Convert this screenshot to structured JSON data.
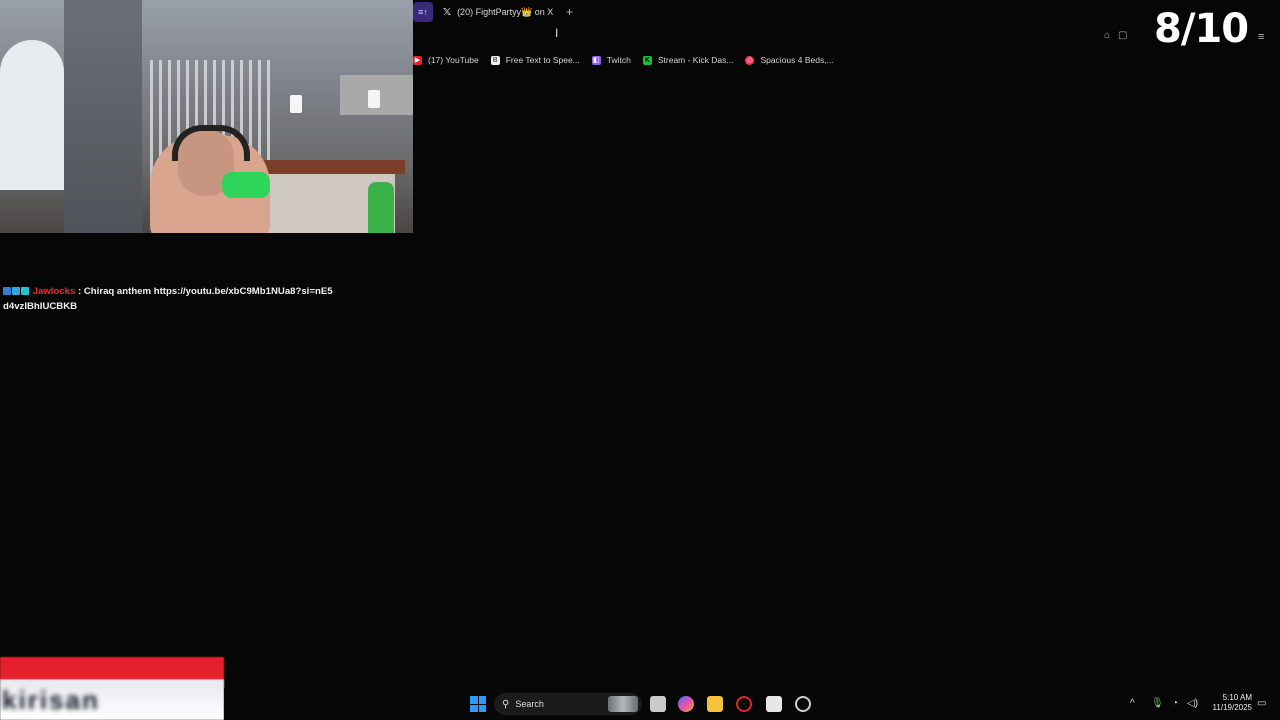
{
  "stream_overlay": {
    "score": "8/10"
  },
  "browser": {
    "tabs": [
      {
        "label": "(20) FightPartyy👑 on X",
        "active": false
      }
    ],
    "new_tab_icon": "plus-icon",
    "bookmarks": [
      {
        "label": "(17) YouTube",
        "icon": "youtube-icon"
      },
      {
        "label": "Free Text to Spee...",
        "icon": "document-icon"
      },
      {
        "label": "Twitch",
        "icon": "twitch-icon"
      },
      {
        "label": "Stream - Kick Das...",
        "icon": "kick-icon"
      },
      {
        "label": "Spacious 4 Beds,...",
        "icon": "airbnb-icon"
      }
    ]
  },
  "chat": {
    "username": "Jawlocks",
    "separator": " : ",
    "message": "Chiraq anthem https://youtu.be/xbC9Mb1NUa8?si=nE5d4vzIBhIUCBKB"
  },
  "taskbar": {
    "search_placeholder": "Search",
    "time": "5:10 AM",
    "date": "11/19/2025"
  },
  "colors": {
    "background": "#060606",
    "username": "#e0302e",
    "start": "#2b9bff"
  }
}
